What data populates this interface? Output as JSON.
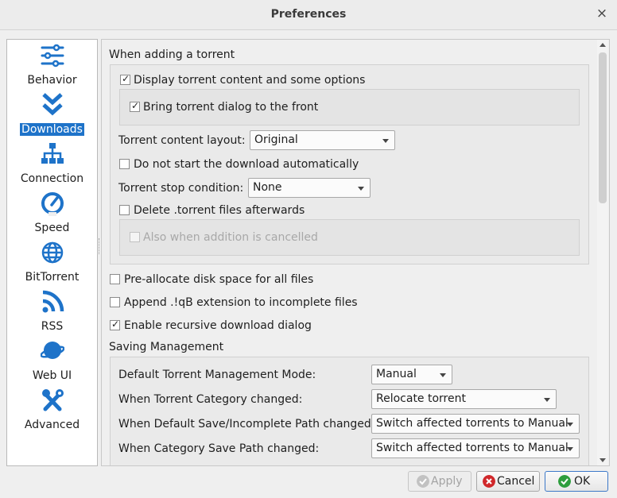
{
  "window": {
    "title": "Preferences",
    "close_glyph": "×"
  },
  "sidebar": {
    "items": [
      {
        "label": "Behavior",
        "icon": "sliders-icon"
      },
      {
        "label": "Downloads",
        "icon": "double-chevron-down-icon",
        "active": true
      },
      {
        "label": "Connection",
        "icon": "network-icon"
      },
      {
        "label": "Speed",
        "icon": "speedometer-icon"
      },
      {
        "label": "BitTorrent",
        "icon": "globe-icon"
      },
      {
        "label": "RSS",
        "icon": "rss-icon"
      },
      {
        "label": "Web UI",
        "icon": "planet-icon"
      },
      {
        "label": "Advanced",
        "icon": "tools-icon"
      }
    ],
    "accent": "#1e73c9"
  },
  "adding": {
    "title": "When adding a torrent",
    "display_content": {
      "label": "Display torrent content and some options",
      "checked": true
    },
    "bring_front": {
      "label": "Bring torrent dialog to the front",
      "checked": true
    },
    "layout_label": "Torrent content layout:",
    "layout_value": "Original",
    "no_autostart": {
      "label": "Do not start the download automatically",
      "checked": false
    },
    "stop_label": "Torrent stop condition:",
    "stop_value": "None",
    "delete_files": {
      "label": "Delete .torrent files afterwards",
      "checked": false
    },
    "also_cancelled": {
      "label": "Also when addition is cancelled",
      "checked": false,
      "disabled": true
    }
  },
  "options": {
    "preallocate": {
      "label": "Pre-allocate disk space for all files",
      "checked": false
    },
    "append_ext": {
      "label": "Append .!qB extension to incomplete files",
      "checked": false
    },
    "recursive": {
      "label": "Enable recursive download dialog",
      "checked": true
    }
  },
  "saving": {
    "title": "Saving Management",
    "rows": [
      {
        "label": "Default Torrent Management Mode:",
        "value": "Manual"
      },
      {
        "label": "When Torrent Category changed:",
        "value": "Relocate torrent"
      },
      {
        "label": "When Default Save/Incomplete Path changed:",
        "value": "Switch affected torrents to Manual"
      },
      {
        "label": "When Category Save Path changed:",
        "value": "Switch affected torrents to Manual"
      }
    ]
  },
  "buttons": {
    "apply": {
      "label": "Apply",
      "enabled": false
    },
    "cancel": {
      "label": "Cancel"
    },
    "ok": {
      "label": "OK"
    }
  }
}
